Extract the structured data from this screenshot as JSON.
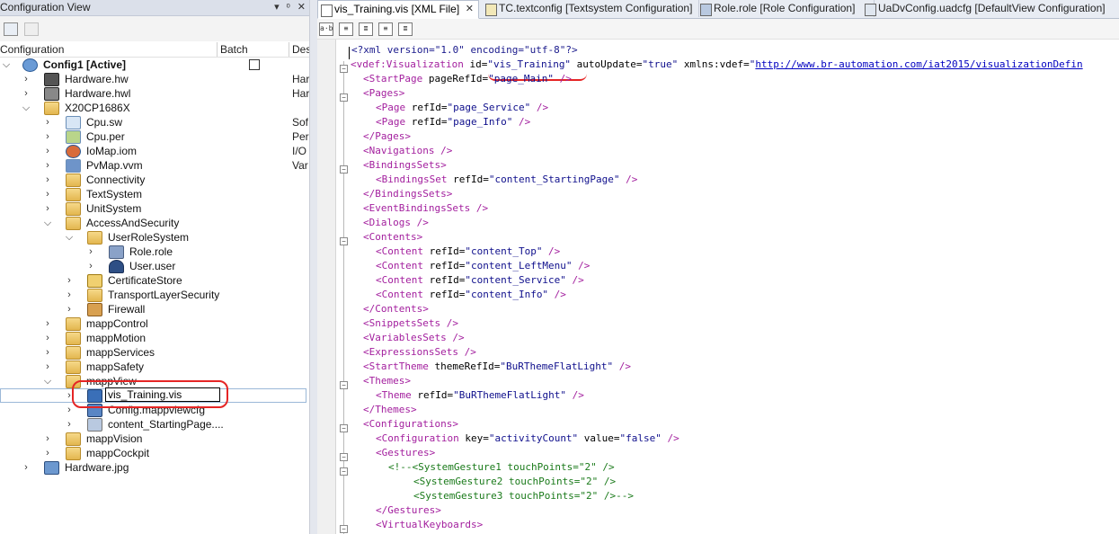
{
  "left_panel": {
    "title": "Configuration View",
    "title_buttons": [
      "▾",
      "ᵒ",
      "✕"
    ],
    "col_headers": {
      "configuration": "Configuration",
      "batch": "Batch",
      "description": "Des"
    },
    "rows": [
      {
        "label": "Config1 [Active]",
        "desc": ""
      },
      {
        "label": "Hardware.hw",
        "desc": "Har"
      },
      {
        "label": "Hardware.hwl",
        "desc": "Har"
      },
      {
        "label": "X20CP1686X",
        "desc": ""
      },
      {
        "label": "Cpu.sw",
        "desc": "Sof"
      },
      {
        "label": "Cpu.per",
        "desc": "Per"
      },
      {
        "label": "IoMap.iom",
        "desc": "I/O"
      },
      {
        "label": "PvMap.vvm",
        "desc": "Var"
      },
      {
        "label": "Connectivity",
        "desc": ""
      },
      {
        "label": "TextSystem",
        "desc": ""
      },
      {
        "label": "UnitSystem",
        "desc": ""
      },
      {
        "label": "AccessAndSecurity",
        "desc": ""
      },
      {
        "label": "UserRoleSystem",
        "desc": ""
      },
      {
        "label": "Role.role",
        "desc": ""
      },
      {
        "label": "User.user",
        "desc": ""
      },
      {
        "label": "CertificateStore",
        "desc": ""
      },
      {
        "label": "TransportLayerSecurity",
        "desc": ""
      },
      {
        "label": "Firewall",
        "desc": ""
      },
      {
        "label": "mappControl",
        "desc": ""
      },
      {
        "label": "mappMotion",
        "desc": ""
      },
      {
        "label": "mappServices",
        "desc": ""
      },
      {
        "label": "mappSafety",
        "desc": ""
      },
      {
        "label": "mappView",
        "desc": ""
      },
      {
        "label": "vis_Training.vis",
        "desc": ""
      },
      {
        "label": "Config.mappviewcfg",
        "desc": ""
      },
      {
        "label": "content_StartingPage....",
        "desc": ""
      },
      {
        "label": "mappVision",
        "desc": ""
      },
      {
        "label": "mappCockpit",
        "desc": ""
      },
      {
        "label": "Hardware.jpg",
        "desc": ""
      }
    ]
  },
  "tabs": [
    {
      "label": "vis_Training.vis [XML File]",
      "close": "✕"
    },
    {
      "label": "TC.textconfig [Textsystem Configuration]"
    },
    {
      "label": "Role.role [Role Configuration]"
    },
    {
      "label": "UaDvConfig.uadcfg [DefaultView Configuration]"
    }
  ],
  "editor_toolbar": [
    "a·b",
    "≡",
    "≣",
    "≡",
    "≣"
  ],
  "code": {
    "l0": {
      "a": "<?xml version=\"1.0\" encoding=\"utf-8\"?>"
    },
    "l1": {
      "a": "<vdef:Visualization",
      "b": " id=",
      "c": "\"vis_Training\"",
      "d": " autoUpdate=",
      "e": "\"true\"",
      "f": " xmlns:vdef=",
      "g": "\"",
      "h": "http://www.br-automation.com/iat2015/visualizationDefin"
    },
    "l2": {
      "a": "<StartPage",
      "b": " pageRefId=",
      "c": "\"page_Main\"",
      "d": " />"
    },
    "l3": {
      "a": "<Pages>"
    },
    "l4": {
      "a": "<Page",
      "b": " refId=",
      "c": "\"page_Service\"",
      "d": " />"
    },
    "l5": {
      "a": "<Page",
      "b": " refId=",
      "c": "\"page_Info\"",
      "d": " />"
    },
    "l6": {
      "a": "</Pages>"
    },
    "l7": {
      "a": "<Navigations />"
    },
    "l8": {
      "a": "<BindingsSets>"
    },
    "l9": {
      "a": "<BindingsSet",
      "b": " refId=",
      "c": "\"content_StartingPage\"",
      "d": " />"
    },
    "l10": {
      "a": "</BindingsSets>"
    },
    "l11": {
      "a": "<EventBindingsSets />"
    },
    "l12": {
      "a": "<Dialogs />"
    },
    "l13": {
      "a": "<Contents>"
    },
    "l14": {
      "a": "<Content",
      "b": " refId=",
      "c": "\"content_Top\"",
      "d": " />"
    },
    "l15": {
      "a": "<Content",
      "b": " refId=",
      "c": "\"content_LeftMenu\"",
      "d": " />"
    },
    "l16": {
      "a": "<Content",
      "b": " refId=",
      "c": "\"content_Service\"",
      "d": " />"
    },
    "l17": {
      "a": "<Content",
      "b": " refId=",
      "c": "\"content_Info\"",
      "d": " />"
    },
    "l18": {
      "a": "</Contents>"
    },
    "l19": {
      "a": "<SnippetsSets />"
    },
    "l20": {
      "a": "<VariablesSets />"
    },
    "l21": {
      "a": "<ExpressionsSets />"
    },
    "l22": {
      "a": "<StartTheme",
      "b": " themeRefId=",
      "c": "\"BuRThemeFlatLight\"",
      "d": " />"
    },
    "l23": {
      "a": "<Themes>"
    },
    "l24": {
      "a": "<Theme",
      "b": " refId=",
      "c": "\"BuRThemeFlatLight\"",
      "d": " />"
    },
    "l25": {
      "a": "</Themes>"
    },
    "l26": {
      "a": "<Configurations>"
    },
    "l27": {
      "a": "<Configuration",
      "b": " key=",
      "c": "\"activityCount\"",
      "d": " value=",
      "e": "\"false\"",
      "f": " />"
    },
    "l28": {
      "a": "<Gestures>"
    },
    "l29": {
      "a": "<!--<SystemGesture1 touchPoints=\"2\" />"
    },
    "l30": {
      "a": "<SystemGesture2 touchPoints=\"2\" />"
    },
    "l31": {
      "a": "<SystemGesture3 touchPoints=\"2\" />-->"
    },
    "l32": {
      "a": "</Gestures>"
    },
    "l33": {
      "a": "<VirtualKeyboards>"
    }
  }
}
